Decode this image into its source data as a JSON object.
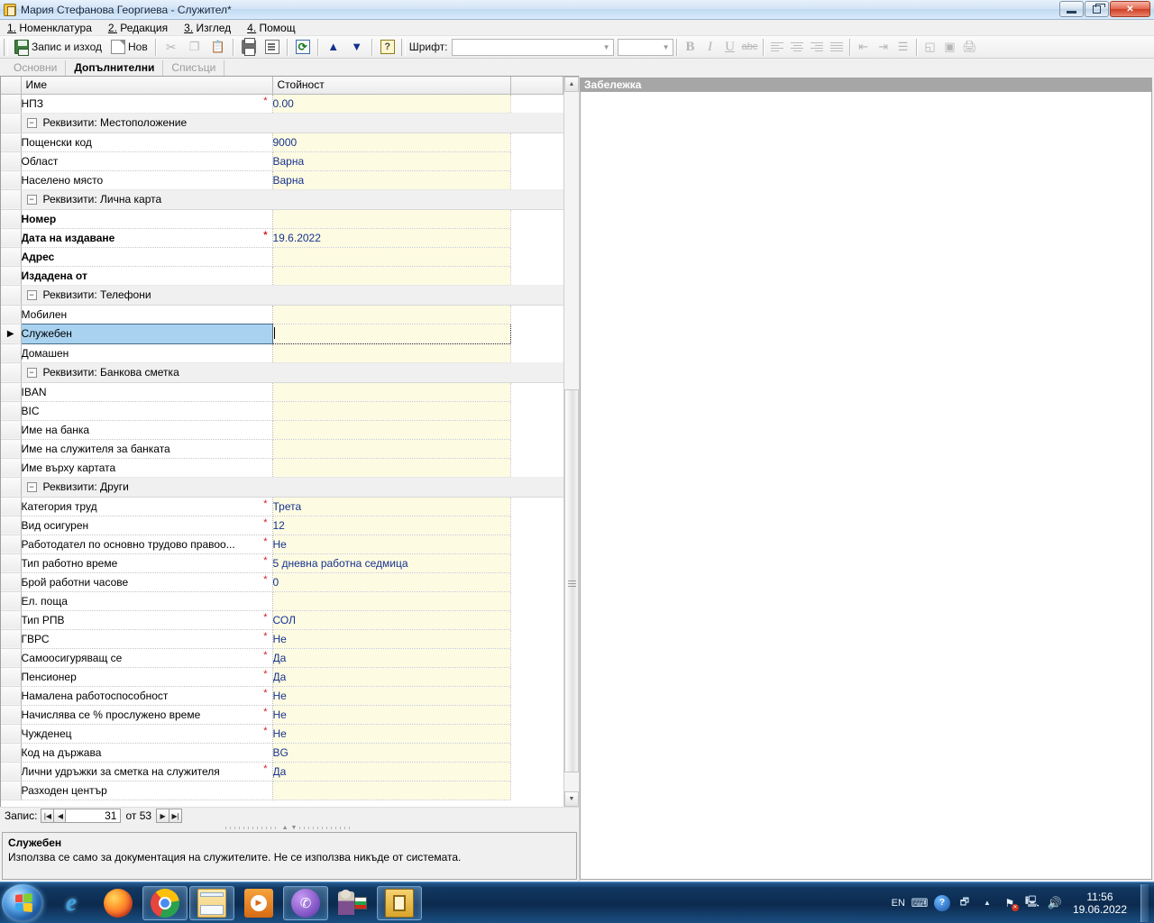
{
  "window": {
    "title": "Мария Стефанова Георгиева - Служител*",
    "app_icon": "document-app-icon",
    "buttons": {
      "minimize": "minimize-icon",
      "restore": "restore-icon",
      "close": "✕"
    }
  },
  "menu": [
    {
      "accel": "1.",
      "label": " Номенклатура"
    },
    {
      "accel": "2.",
      "label": " Редакция"
    },
    {
      "accel": "3.",
      "label": " Изглед"
    },
    {
      "accel": "4.",
      "label": " Помощ"
    }
  ],
  "toolbar": {
    "save_exit_label": "Запис и изход",
    "new_label": "Нов",
    "font_label": "Шрифт:",
    "font_value": "",
    "font_size_value": "",
    "icons": [
      "save-icon",
      "new-icon",
      "cut-icon",
      "copy-icon",
      "paste-icon",
      "print-icon",
      "print-preview-icon",
      "refresh-icon",
      "move-up-icon",
      "move-down-icon",
      "help-icon"
    ],
    "format_icons": [
      "bold-icon",
      "italic-icon",
      "underline-icon",
      "strikethrough-icon",
      "align-left-icon",
      "align-center-icon",
      "align-right-icon",
      "justify-icon",
      "outdent-icon",
      "indent-icon",
      "bullet-list-icon",
      "border-icon",
      "image-icon",
      "print-color-icon"
    ],
    "format_letters": {
      "bold": "B",
      "italic": "I",
      "underline": "U",
      "strike": "abc"
    }
  },
  "tabs": [
    {
      "label": "Основни",
      "active": false
    },
    {
      "label": "Допълнителни",
      "active": true
    },
    {
      "label": "Списъци",
      "active": false
    }
  ],
  "grid": {
    "columns": [
      "Име",
      "Стойност"
    ],
    "rows": [
      {
        "type": "field",
        "name": "НПЗ",
        "required": true,
        "value": "0.00",
        "bold": false
      },
      {
        "type": "group",
        "name": "Реквизити: Местоположение"
      },
      {
        "type": "field",
        "name": "Пощенски код",
        "required": false,
        "value": "9000",
        "bold": false
      },
      {
        "type": "field",
        "name": "Област",
        "required": false,
        "value": "Варна",
        "bold": false
      },
      {
        "type": "field",
        "name": "Населено място",
        "required": false,
        "value": "Варна",
        "bold": false
      },
      {
        "type": "group",
        "name": "Реквизити: Лична карта"
      },
      {
        "type": "field",
        "name": "Номер",
        "required": false,
        "value": "",
        "bold": true
      },
      {
        "type": "field",
        "name": "Дата на издаване",
        "required": true,
        "value": "19.6.2022",
        "bold": true
      },
      {
        "type": "field",
        "name": "Адрес",
        "required": false,
        "value": "",
        "bold": true
      },
      {
        "type": "field",
        "name": "Издадена от",
        "required": false,
        "value": "",
        "bold": true
      },
      {
        "type": "group",
        "name": "Реквизити: Телефони"
      },
      {
        "type": "field",
        "name": "Мобилен",
        "required": false,
        "value": "",
        "bold": false
      },
      {
        "type": "field",
        "name": "Служебен",
        "required": false,
        "value": "",
        "bold": false,
        "selected": true
      },
      {
        "type": "field",
        "name": "Домашен",
        "required": false,
        "value": "",
        "bold": false
      },
      {
        "type": "group",
        "name": "Реквизити: Банкова сметка"
      },
      {
        "type": "field",
        "name": "IBAN",
        "required": false,
        "value": "",
        "bold": false
      },
      {
        "type": "field",
        "name": "BIC",
        "required": false,
        "value": "",
        "bold": false
      },
      {
        "type": "field",
        "name": "Име на банка",
        "required": false,
        "value": "",
        "bold": false
      },
      {
        "type": "field",
        "name": "Име на служителя за банката",
        "required": false,
        "value": "",
        "bold": false
      },
      {
        "type": "field",
        "name": "Име върху картата",
        "required": false,
        "value": "",
        "bold": false
      },
      {
        "type": "group",
        "name": "Реквизити: Други"
      },
      {
        "type": "field",
        "name": "Категория труд",
        "required": true,
        "value": "Трета",
        "bold": false
      },
      {
        "type": "field",
        "name": "Вид осигурен",
        "required": true,
        "value": "12",
        "bold": false
      },
      {
        "type": "field",
        "name": "Работодател по основно трудово правоо...",
        "required": true,
        "value": "Не",
        "bold": false
      },
      {
        "type": "field",
        "name": "Тип работно време",
        "required": true,
        "value": "5 дневна работна седмица",
        "bold": false
      },
      {
        "type": "field",
        "name": "Брой работни часове",
        "required": true,
        "value": "0",
        "bold": false
      },
      {
        "type": "field",
        "name": "Ел. поща",
        "required": false,
        "value": "",
        "bold": false
      },
      {
        "type": "field",
        "name": "Тип РПВ",
        "required": true,
        "value": "СОЛ",
        "bold": false
      },
      {
        "type": "field",
        "name": "ГВРС",
        "required": true,
        "value": "Не",
        "bold": false
      },
      {
        "type": "field",
        "name": "Самоосигуряващ се",
        "required": true,
        "value": "Да",
        "bold": false
      },
      {
        "type": "field",
        "name": "Пенсионер",
        "required": true,
        "value": "Да",
        "bold": false
      },
      {
        "type": "field",
        "name": "Намалена работоспособност",
        "required": true,
        "value": "Не",
        "bold": false
      },
      {
        "type": "field",
        "name": "Начислява се % прослужено време",
        "required": true,
        "value": "Не",
        "bold": false
      },
      {
        "type": "field",
        "name": "Чужденец",
        "required": true,
        "value": "Не",
        "bold": false
      },
      {
        "type": "field",
        "name": "Код на държава",
        "required": false,
        "value": "BG",
        "bold": false
      },
      {
        "type": "field",
        "name": "Лични удръжки за сметка на служителя",
        "required": true,
        "value": "Да",
        "bold": false
      },
      {
        "type": "field",
        "name": "Разходен център",
        "required": false,
        "value": "",
        "bold": false
      }
    ]
  },
  "navigator": {
    "label": "Запис:",
    "current": "31",
    "of_label": "от 53",
    "first_icon": "first-record-icon",
    "prev_icon": "previous-record-icon",
    "next_icon": "next-record-icon",
    "last_icon": "last-record-icon"
  },
  "description": {
    "title": "Служебен",
    "text": "Използва се само за документация на служителите. Не се използва никъде от системата."
  },
  "note_pane": {
    "header": "Забележка",
    "content": ""
  },
  "taskbar": {
    "start": "windows-start-orb",
    "apps": [
      {
        "name": "internet-explorer-icon",
        "framed": false
      },
      {
        "name": "firefox-icon",
        "framed": false
      },
      {
        "name": "google-chrome-icon",
        "framed": true
      },
      {
        "name": "file-explorer-icon",
        "framed": true
      },
      {
        "name": "media-player-icon",
        "framed": false
      },
      {
        "name": "viber-icon",
        "framed": true
      },
      {
        "name": "bulgarian-app-icon",
        "framed": false
      },
      {
        "name": "payroll-app-icon",
        "framed": true
      }
    ],
    "tray": {
      "language": "EN",
      "icons": [
        "keyboard-icon",
        "help-icon",
        "multi-monitor-icon",
        "show-hidden-icons-icon",
        "network-error-icon",
        "action-center-icon",
        "volume-icon"
      ],
      "time": "11:56",
      "date": "19.06.2022"
    }
  },
  "colors": {
    "value_text": "#17328f",
    "required_star": "#d02020",
    "value_cell_bg": "#fdfbe2",
    "selection_bg": "#a8d2f0",
    "note_header_bg": "#a6a6a6"
  }
}
